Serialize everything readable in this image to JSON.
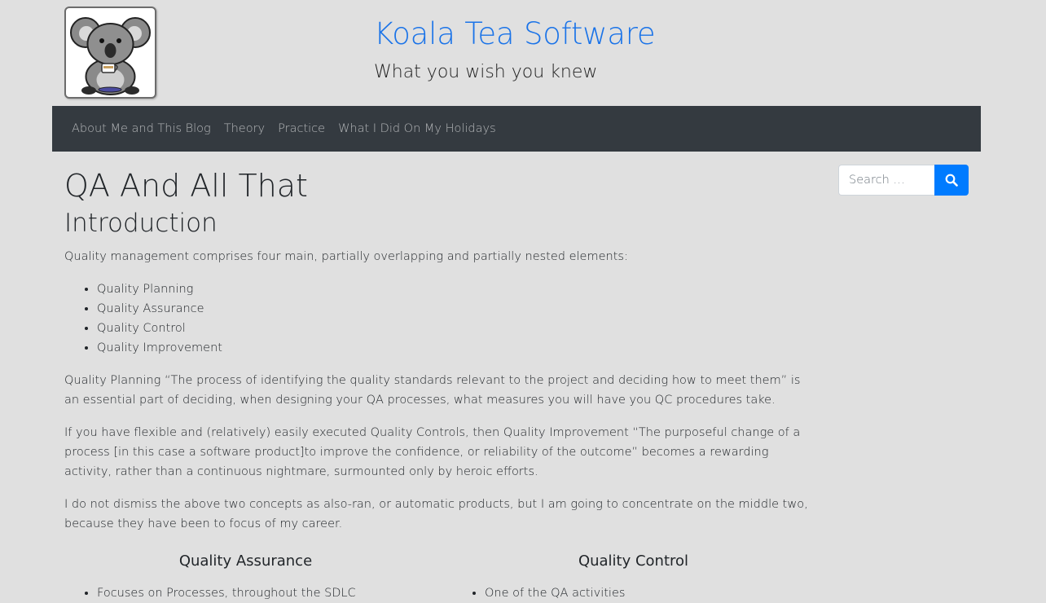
{
  "header": {
    "logo_alt": "Koala Tea Software logo",
    "title": "Koala Tea Software",
    "tagline": "What you wish you knew"
  },
  "nav": {
    "items": [
      {
        "label": "About Me and This Blog"
      },
      {
        "label": "Theory"
      },
      {
        "label": "Practice"
      },
      {
        "label": "What I Did On My Holidays"
      }
    ]
  },
  "search": {
    "placeholder": "Search …",
    "button_icon": "search-icon"
  },
  "article": {
    "title": "QA And All That",
    "section_heading": "Introduction",
    "intro": "Quality management comprises four main, partially overlapping and partially nested elements:",
    "elements": [
      "Quality Planning",
      "Quality Assurance",
      "Quality Control",
      "Quality Improvement"
    ],
    "paragraphs": [
      "Quality Planning “The process of identifying the quality standards relevant to the project and deciding how to meet them” is an essential part of deciding, when designing your QA processes, what measures you will have you QC procedures take.",
      "If you have flexible and (relatively) easily executed Quality Controls, then Quality Improvement “The purposeful change of a process [in this case a software product]to improve the confidence, or reliability of the outcome” becomes a rewarding activity, rather than a continuous nightmare, surmounted only by heroic efforts.",
      "I do not dismiss the above two concepts as also-ran, or automatic products, but I am going to concentrate on the middle two, because they have been to focus of my career."
    ],
    "columns": [
      {
        "heading": "Quality Assurance",
        "items": [
          "Focuses on Processes, throughout the SDLC"
        ]
      },
      {
        "heading": "Quality Control",
        "items": [
          "One of the QA activities"
        ]
      }
    ]
  },
  "colors": {
    "background": "#e0e0e0",
    "navbar": "#343a40",
    "title_link": "#1a73e8",
    "search_button": "#007bff"
  }
}
